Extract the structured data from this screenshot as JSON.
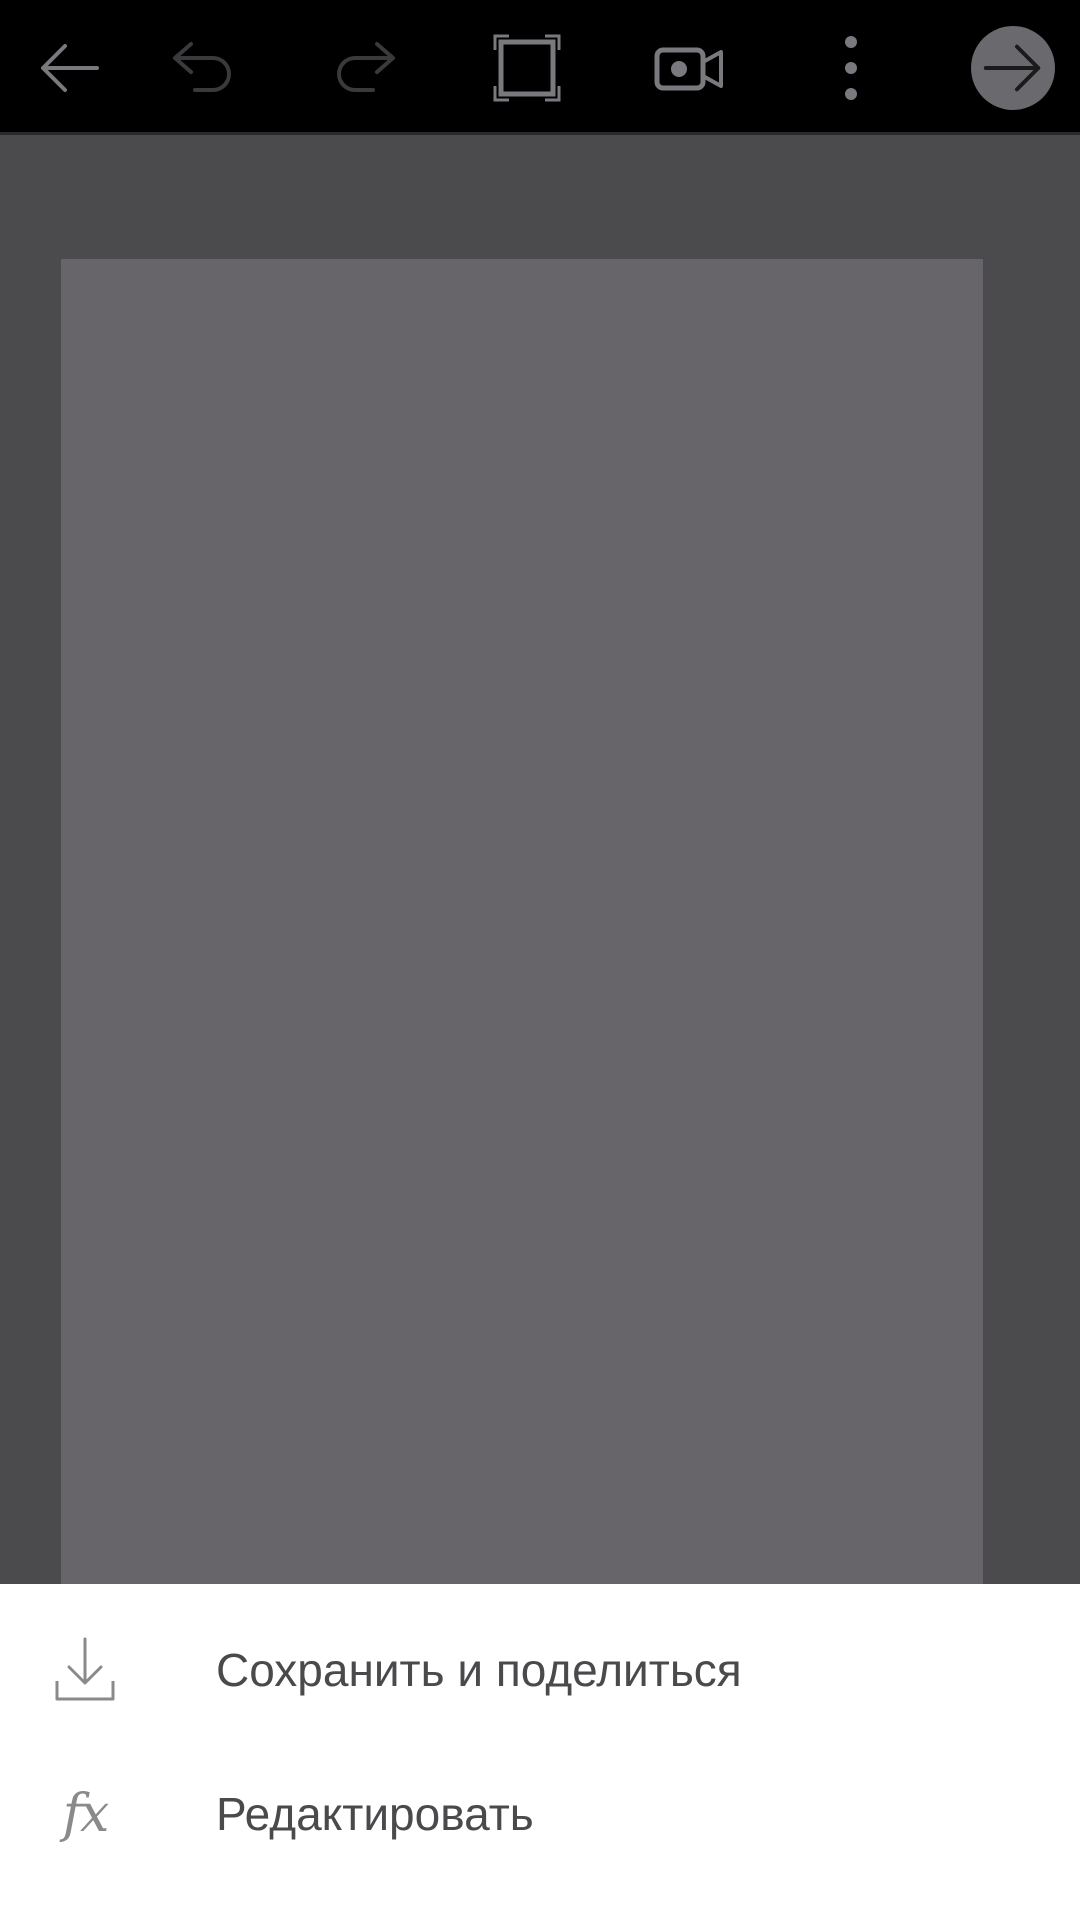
{
  "toolbar": {
    "icons": {
      "back": "arrow-left-icon",
      "undo": "undo-icon",
      "redo": "redo-icon",
      "fit": "fit-screen-icon",
      "record": "video-camera-icon",
      "more": "more-vertical-icon",
      "next": "arrow-right-icon"
    },
    "states": {
      "undo_enabled": false,
      "redo_enabled": false
    }
  },
  "menu": {
    "items": [
      {
        "label": "Сохранить и поделиться",
        "icon": "download-icon"
      },
      {
        "label": "Редактировать",
        "icon": "fx-icon",
        "glyph": "fx"
      }
    ]
  },
  "colors": {
    "toolbar_bg": "#000000",
    "workspace_bg": "#4b4a4d",
    "canvas_bg": "#676569",
    "sheet_bg": "#ffffff",
    "next_button_bg": "#6a696d",
    "menu_text": "#4a4a4c",
    "icon_gray": "#8a8a8c"
  }
}
